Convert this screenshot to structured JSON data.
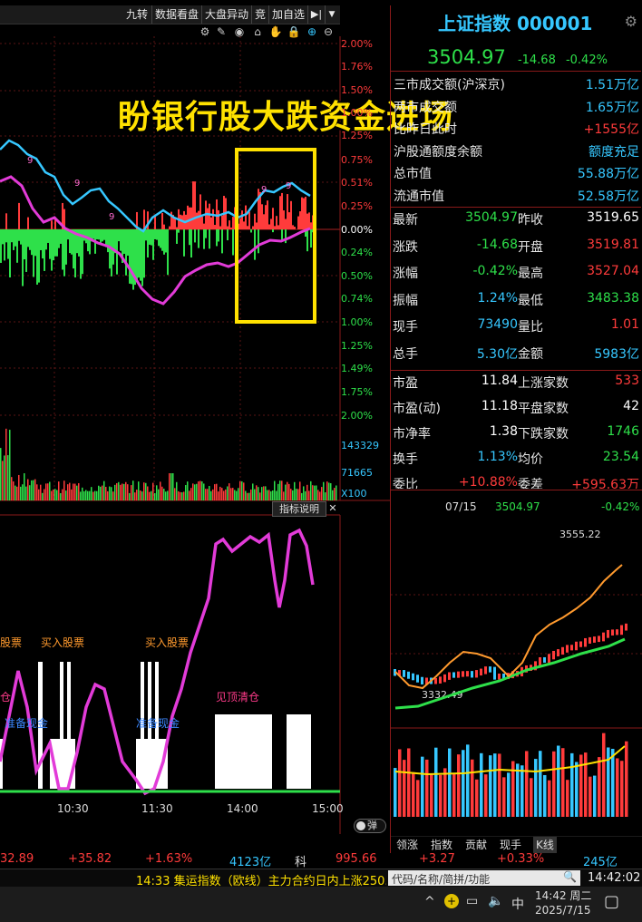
{
  "toolbar": {
    "items": [
      "九转",
      "数据看盘",
      "大盘异动",
      "竞",
      "加自选"
    ],
    "icons": [
      "gear-small-icon",
      "pencil-icon",
      "eye-icon",
      "lock-icon",
      "hand-icon",
      "lock-closed-icon",
      "plus-circle-icon",
      "minus-circle-icon"
    ]
  },
  "overlay_caption": "盼银行股大跌资金进场",
  "index": {
    "name": "上证指数",
    "code": "000001",
    "price": "3504.97",
    "change": "-14.68",
    "change_pct": "-0.42%"
  },
  "stats": [
    {
      "label": "三市成交额(沪深京)",
      "value": "1.51万亿",
      "color": "cyan"
    },
    {
      "label": "两市成交额",
      "value": "1.65万亿",
      "color": "cyan"
    },
    {
      "label": "比昨日此时",
      "value": "+1555亿",
      "color": "red"
    },
    {
      "label": "沪股通额度余额",
      "value": "额度充足",
      "color": "cyan"
    },
    {
      "label": "总市值",
      "value": "55.88万亿",
      "color": "cyan"
    },
    {
      "label": "流通市值",
      "value": "52.58万亿",
      "color": "cyan"
    }
  ],
  "quote": [
    {
      "l1": "最新",
      "v1": "3504.97",
      "c1": "green",
      "l2": "昨收",
      "v2": "3519.65",
      "c2": "white"
    },
    {
      "l1": "涨跌",
      "v1": "-14.68",
      "c1": "green",
      "l2": "开盘",
      "v2": "3519.81",
      "c2": "red"
    },
    {
      "l1": "涨幅",
      "v1": "-0.42%",
      "c1": "green",
      "l2": "最高",
      "v2": "3527.04",
      "c2": "red"
    },
    {
      "l1": "振幅",
      "v1": "1.24%",
      "c1": "cyan",
      "l2": "最低",
      "v2": "3483.38",
      "c2": "green"
    },
    {
      "l1": "现手",
      "v1": "73490",
      "c1": "cyan",
      "l2": "量比",
      "v2": "1.01",
      "c2": "red"
    },
    {
      "l1": "总手",
      "v1": "5.30亿",
      "c1": "cyan",
      "l2": "金额",
      "v2": "5983亿",
      "c2": "cyan"
    }
  ],
  "breadth": [
    {
      "l1": "市盈",
      "v1": "11.84",
      "c1": "white",
      "l2": "上涨家数",
      "v2": "533",
      "c2": "red"
    },
    {
      "l1": "市盈(动)",
      "v1": "11.18",
      "c1": "white",
      "l2": "平盘家数",
      "v2": "42",
      "c2": "white"
    },
    {
      "l1": "市净率",
      "v1": "1.38",
      "c1": "white",
      "l2": "下跌家数",
      "v2": "1746",
      "c2": "green"
    },
    {
      "l1": "换手",
      "v1": "1.13%",
      "c1": "cyan",
      "l2": "均价",
      "v2": "23.54",
      "c2": "green"
    },
    {
      "l1": "委比",
      "v1": "+10.88%",
      "c1": "red",
      "l2": "委差",
      "v2": "+595.63万",
      "c2": "red"
    }
  ],
  "pct_axis": {
    "up": [
      "2.00%",
      "1.76%",
      "1.50%",
      "1.25%",
      "1.00%",
      "0.75%",
      "0.51%",
      "0.25%"
    ],
    "zero": "0.00%",
    "down": [
      "0.24%",
      "0.50%",
      "0.74%",
      "1.00%",
      "1.25%",
      "1.49%",
      "1.75%",
      "2.00%"
    ]
  },
  "volume_axis": [
    "143329",
    "71665",
    "X100"
  ],
  "indicator_panel": {
    "title": "指标说明",
    "close": "✕"
  },
  "indicator_labels": {
    "buy1": "买入股票",
    "buy2": "买入股票",
    "stock_left": "股票",
    "ready1": "准备现金",
    "ready2": "准备现金",
    "left_char": "仓",
    "right_text": "见顶清仓"
  },
  "time_axis": [
    "10:30",
    "11:30",
    "14:00",
    "15:00"
  ],
  "popup_btn": "弹",
  "kline": {
    "date": "07/15",
    "price": "3504.97",
    "pct": "-0.42%",
    "high_label": "3555.22",
    "low_label": "3332.49"
  },
  "mini_tabs": [
    "领涨",
    "指数",
    "贡献",
    "现手",
    "K线"
  ],
  "bottom_strip": [
    "32.89",
    "+35.82",
    "+1.63%",
    "4123亿",
    "科",
    "995.66",
    "+3.27",
    "+0.33%",
    "245亿"
  ],
  "ticker": {
    "text": "14:33 集运指数（欧线）主力合约日内上涨250.",
    "search_placeholder": "代码/名称/简拼/功能",
    "clock": "14:42:02"
  },
  "taskbar": {
    "time": "14:42 周二",
    "date": "2025/7/15",
    "ime": "中"
  },
  "colors": {
    "up": "#ff3b3b",
    "down": "#2ee04a",
    "line": "#36c7ff",
    "avg": "#e23bd8",
    "highlight": "#ffe100"
  }
}
